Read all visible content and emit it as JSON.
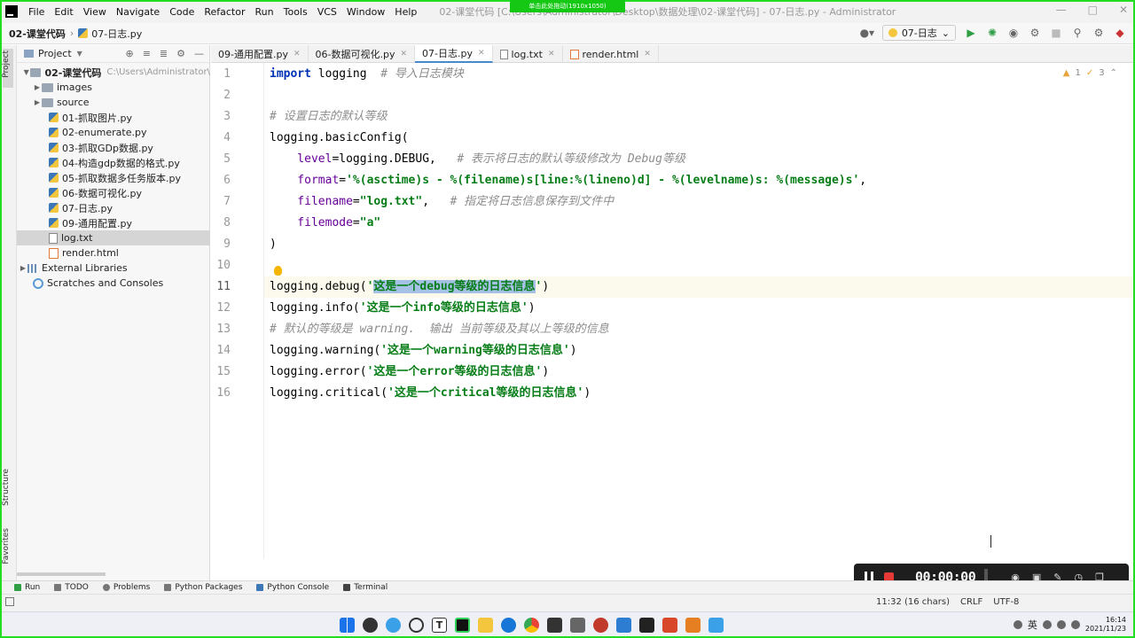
{
  "menubar": {
    "items": [
      "File",
      "Edit",
      "View",
      "Navigate",
      "Code",
      "Refactor",
      "Run",
      "Tools",
      "VCS",
      "Window",
      "Help"
    ],
    "window_title": "02-课堂代码 [C:\\Users\\Administrator\\Desktop\\数据处理\\02-课堂代码] - 07-日志.py - Administrator"
  },
  "recording_banner": "单击此处拖动(1910x1050)",
  "navbar": {
    "project": "02-课堂代码",
    "file": "07-日志.py",
    "run_config": "07-日志"
  },
  "side_labels": {
    "project": "Project",
    "structure": "Structure",
    "favorites": "Favorites"
  },
  "project_panel": {
    "header": "Project",
    "root": {
      "name": "02-课堂代码",
      "path": "C:\\Users\\Administrator\\"
    },
    "items": [
      {
        "name": "images",
        "type": "folder"
      },
      {
        "name": "source",
        "type": "folder"
      },
      {
        "name": "01-抓取图片.py",
        "type": "py"
      },
      {
        "name": "02-enumerate.py",
        "type": "py"
      },
      {
        "name": "03-抓取GDp数据.py",
        "type": "py"
      },
      {
        "name": "04-构造gdp数据的格式.py",
        "type": "py"
      },
      {
        "name": "05-抓取数据多任务版本.py",
        "type": "py"
      },
      {
        "name": "06-数据可视化.py",
        "type": "py"
      },
      {
        "name": "07-日志.py",
        "type": "py"
      },
      {
        "name": "09-通用配置.py",
        "type": "py"
      },
      {
        "name": "log.txt",
        "type": "txt"
      },
      {
        "name": "render.html",
        "type": "html"
      }
    ],
    "external_libraries": "External Libraries",
    "scratches": "Scratches and Consoles"
  },
  "tabs": [
    {
      "label": "09-通用配置.py"
    },
    {
      "label": "06-数据可视化.py"
    },
    {
      "label": "07-日志.py",
      "active": true
    },
    {
      "label": "log.txt"
    },
    {
      "label": "render.html"
    }
  ],
  "editor": {
    "inspection": {
      "warnings": "1",
      "weak": "3"
    },
    "line_numbers": [
      "1",
      "2",
      "3",
      "4",
      "5",
      "6",
      "7",
      "8",
      "9",
      "10",
      "11",
      "12",
      "13",
      "14",
      "15",
      "16"
    ],
    "current_line": 11,
    "lines": {
      "l1_kw": "import",
      "l1_mod": " logging  ",
      "l1_cm": "# 导入日志模块",
      "l3_cm": "# 设置日志的默认等级",
      "l4": "logging.basicConfig(",
      "l5_prm": "    level",
      "l5_code": "=logging.DEBUG,   ",
      "l5_cm": "# 表示将日志的默认等级修改为 Debug等级",
      "l6_prm": "    format",
      "l6_eq": "=",
      "l6_str": "'%(asctime)s - %(filename)s[line:%(lineno)d] - %(levelname)s: %(message)s'",
      "l6_end": ",",
      "l7_prm": "    filename",
      "l7_eq": "=",
      "l7_str": "\"log.txt\"",
      "l7_end": ",   ",
      "l7_cm": "# 指定将日志信息保存到文件中",
      "l8_prm": "    filemode",
      "l8_eq": "=",
      "l8_str": "\"a\"",
      "l9": ")",
      "l11_pre": "logging.debug(",
      "l11_q1": "'",
      "l11_sel": "这是一个debug等级的日志信息",
      "l11_q2": "'",
      "l11_end": ")",
      "l12_pre": "logging.info(",
      "l12_str": "'这是一个info等级的日志信息'",
      "l12_end": ")",
      "l13_cm": "# 默认的等级是 warning.  输出 当前等级及其以上等级的信息",
      "l14_pre": "logging.warning(",
      "l14_str": "'这是一个warning等级的日志信息'",
      "l14_end": ")",
      "l15_pre": "logging.error(",
      "l15_str": "'这是一个error等级的日志信息'",
      "l15_end": ")",
      "l16_pre": "logging.critical(",
      "l16_str": "'这是一个critical等级的日志信息'",
      "l16_end": ")"
    }
  },
  "bottom_tools": [
    "Run",
    "TODO",
    "Problems",
    "Python Packages",
    "Python Console",
    "Terminal"
  ],
  "statusbar": {
    "position": "11:32 (16 chars)",
    "line_sep": "CRLF",
    "encoding": "UTF-8"
  },
  "recorder": {
    "time": "00:00:00"
  },
  "taskbar": {
    "ime": "英",
    "time": "16:14",
    "date": "2021/11/23"
  },
  "colors": {
    "keyword": "#0033b3",
    "string": "#067d17",
    "comment": "#8c8c8c",
    "param": "#660099",
    "selection": "#a6c1e6",
    "record_frame": "#22dd22"
  }
}
